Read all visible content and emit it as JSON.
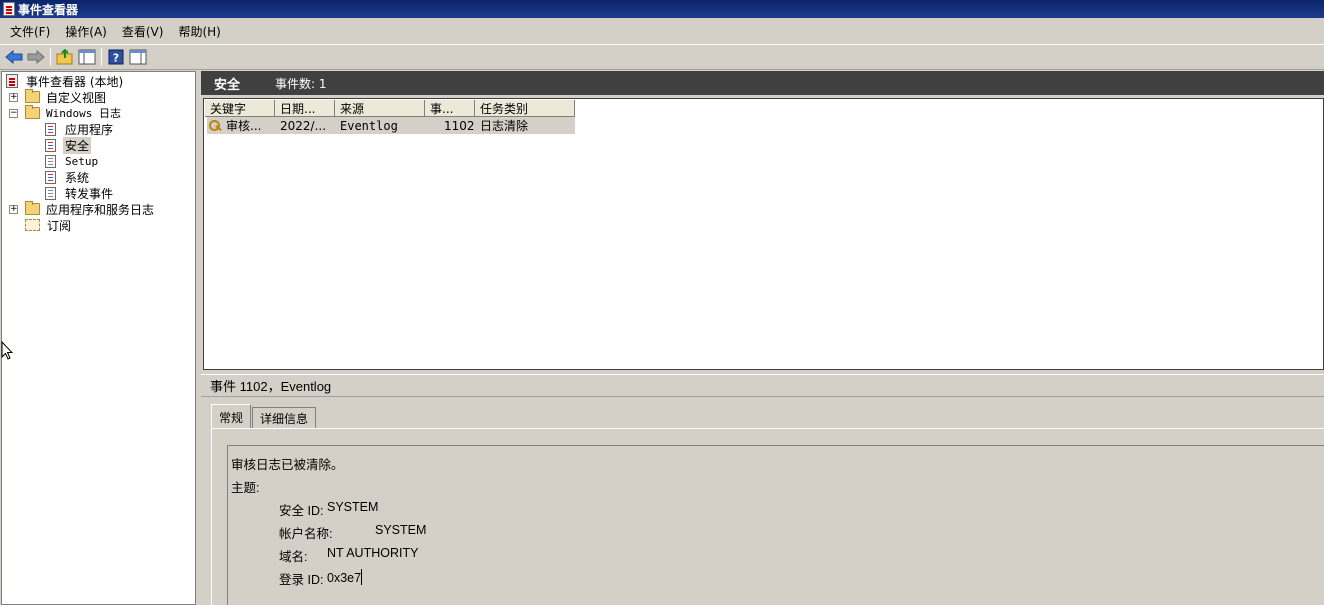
{
  "window": {
    "title": "事件查看器"
  },
  "menu": [
    "文件(F)",
    "操作(A)",
    "查看(V)",
    "帮助(H)"
  ],
  "toolbar": {
    "icons": [
      "back-arrow-icon",
      "forward-arrow-icon",
      "up-folder-icon",
      "show-hide-tree-icon",
      "help-icon",
      "show-hide-action-pane-icon"
    ]
  },
  "tree": {
    "root": "事件查看器 (本地)",
    "custom_views": "自定义视图",
    "windows_logs": "Windows 日志",
    "application": "应用程序",
    "security": "安全",
    "setup": "Setup",
    "system": "系统",
    "forwarded": "转发事件",
    "app_service_logs": "应用程序和服务日志",
    "subscriptions": "订阅"
  },
  "list_header": {
    "title": "安全",
    "count_label": "事件数: 1"
  },
  "columns": [
    "关键字",
    "日期...",
    "来源",
    "事...",
    "任务类别"
  ],
  "rows": [
    {
      "keyword": "审核...",
      "date": "2022/...",
      "source": "Eventlog",
      "event_id": "1102",
      "task_category": "日志清除"
    }
  ],
  "detail": {
    "title": "事件 1102，Eventlog",
    "tabs": [
      "常规",
      "详细信息"
    ],
    "message": {
      "line1": "审核日志已被清除。",
      "line2": "主题:",
      "security_id_label": "安全 ID:",
      "security_id": "SYSTEM",
      "account_name_label": "帐户名称:",
      "account_name": "SYSTEM",
      "domain_label": "域名:",
      "domain": "NT AUTHORITY",
      "logon_id_label": "登录 ID:",
      "logon_id": "0x3e7"
    }
  }
}
